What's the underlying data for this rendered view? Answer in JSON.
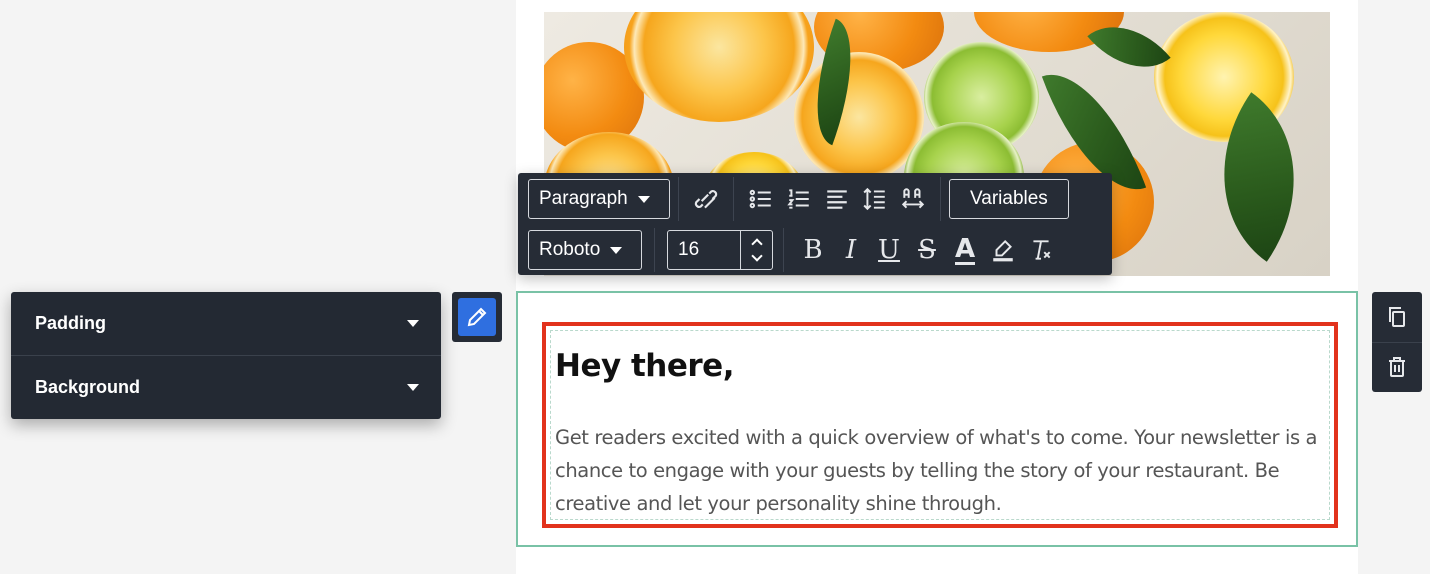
{
  "toolbar": {
    "block_type": "Paragraph",
    "font_family": "Roboto",
    "font_size": "16",
    "variables_label": "Variables",
    "icons": [
      "unlink-icon",
      "bullet-list-icon",
      "numbered-list-icon",
      "align-left-icon",
      "line-height-icon",
      "letter-spacing-icon",
      "bold-icon",
      "italic-icon",
      "underline-icon",
      "strikethrough-icon",
      "text-color-icon",
      "highlight-icon",
      "clear-format-icon"
    ],
    "format_glyphs": {
      "bold": "B",
      "italic": "I",
      "underline": "U",
      "strike": "S",
      "color": "A"
    }
  },
  "settings": {
    "items": [
      {
        "label": "Padding"
      },
      {
        "label": "Background"
      }
    ]
  },
  "content": {
    "heading": "Hey there,",
    "paragraph": "Get readers excited with a quick overview of what's to come. Your newsletter is a chance to engage with your guests by telling the story of your restaurant. Be creative and let your personality shine through."
  },
  "colors": {
    "selection_border": "#e2321c",
    "block_outline": "#79c2a6",
    "toolbar_bg": "#262c36",
    "edit_accent": "#2f6fe0"
  }
}
